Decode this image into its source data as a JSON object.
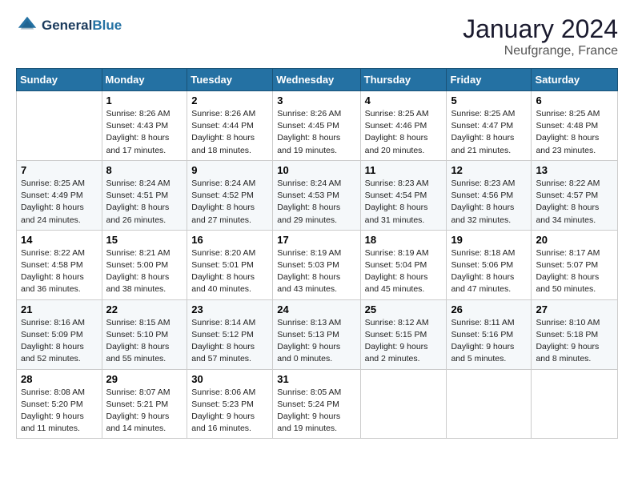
{
  "header": {
    "logo_line1": "General",
    "logo_line2": "Blue",
    "month": "January 2024",
    "location": "Neufgrange, France"
  },
  "weekdays": [
    "Sunday",
    "Monday",
    "Tuesday",
    "Wednesday",
    "Thursday",
    "Friday",
    "Saturday"
  ],
  "weeks": [
    [
      {
        "day": "",
        "info": ""
      },
      {
        "day": "1",
        "info": "Sunrise: 8:26 AM\nSunset: 4:43 PM\nDaylight: 8 hours\nand 17 minutes."
      },
      {
        "day": "2",
        "info": "Sunrise: 8:26 AM\nSunset: 4:44 PM\nDaylight: 8 hours\nand 18 minutes."
      },
      {
        "day": "3",
        "info": "Sunrise: 8:26 AM\nSunset: 4:45 PM\nDaylight: 8 hours\nand 19 minutes."
      },
      {
        "day": "4",
        "info": "Sunrise: 8:25 AM\nSunset: 4:46 PM\nDaylight: 8 hours\nand 20 minutes."
      },
      {
        "day": "5",
        "info": "Sunrise: 8:25 AM\nSunset: 4:47 PM\nDaylight: 8 hours\nand 21 minutes."
      },
      {
        "day": "6",
        "info": "Sunrise: 8:25 AM\nSunset: 4:48 PM\nDaylight: 8 hours\nand 23 minutes."
      }
    ],
    [
      {
        "day": "7",
        "info": "Sunrise: 8:25 AM\nSunset: 4:49 PM\nDaylight: 8 hours\nand 24 minutes."
      },
      {
        "day": "8",
        "info": "Sunrise: 8:24 AM\nSunset: 4:51 PM\nDaylight: 8 hours\nand 26 minutes."
      },
      {
        "day": "9",
        "info": "Sunrise: 8:24 AM\nSunset: 4:52 PM\nDaylight: 8 hours\nand 27 minutes."
      },
      {
        "day": "10",
        "info": "Sunrise: 8:24 AM\nSunset: 4:53 PM\nDaylight: 8 hours\nand 29 minutes."
      },
      {
        "day": "11",
        "info": "Sunrise: 8:23 AM\nSunset: 4:54 PM\nDaylight: 8 hours\nand 31 minutes."
      },
      {
        "day": "12",
        "info": "Sunrise: 8:23 AM\nSunset: 4:56 PM\nDaylight: 8 hours\nand 32 minutes."
      },
      {
        "day": "13",
        "info": "Sunrise: 8:22 AM\nSunset: 4:57 PM\nDaylight: 8 hours\nand 34 minutes."
      }
    ],
    [
      {
        "day": "14",
        "info": "Sunrise: 8:22 AM\nSunset: 4:58 PM\nDaylight: 8 hours\nand 36 minutes."
      },
      {
        "day": "15",
        "info": "Sunrise: 8:21 AM\nSunset: 5:00 PM\nDaylight: 8 hours\nand 38 minutes."
      },
      {
        "day": "16",
        "info": "Sunrise: 8:20 AM\nSunset: 5:01 PM\nDaylight: 8 hours\nand 40 minutes."
      },
      {
        "day": "17",
        "info": "Sunrise: 8:19 AM\nSunset: 5:03 PM\nDaylight: 8 hours\nand 43 minutes."
      },
      {
        "day": "18",
        "info": "Sunrise: 8:19 AM\nSunset: 5:04 PM\nDaylight: 8 hours\nand 45 minutes."
      },
      {
        "day": "19",
        "info": "Sunrise: 8:18 AM\nSunset: 5:06 PM\nDaylight: 8 hours\nand 47 minutes."
      },
      {
        "day": "20",
        "info": "Sunrise: 8:17 AM\nSunset: 5:07 PM\nDaylight: 8 hours\nand 50 minutes."
      }
    ],
    [
      {
        "day": "21",
        "info": "Sunrise: 8:16 AM\nSunset: 5:09 PM\nDaylight: 8 hours\nand 52 minutes."
      },
      {
        "day": "22",
        "info": "Sunrise: 8:15 AM\nSunset: 5:10 PM\nDaylight: 8 hours\nand 55 minutes."
      },
      {
        "day": "23",
        "info": "Sunrise: 8:14 AM\nSunset: 5:12 PM\nDaylight: 8 hours\nand 57 minutes."
      },
      {
        "day": "24",
        "info": "Sunrise: 8:13 AM\nSunset: 5:13 PM\nDaylight: 9 hours\nand 0 minutes."
      },
      {
        "day": "25",
        "info": "Sunrise: 8:12 AM\nSunset: 5:15 PM\nDaylight: 9 hours\nand 2 minutes."
      },
      {
        "day": "26",
        "info": "Sunrise: 8:11 AM\nSunset: 5:16 PM\nDaylight: 9 hours\nand 5 minutes."
      },
      {
        "day": "27",
        "info": "Sunrise: 8:10 AM\nSunset: 5:18 PM\nDaylight: 9 hours\nand 8 minutes."
      }
    ],
    [
      {
        "day": "28",
        "info": "Sunrise: 8:08 AM\nSunset: 5:20 PM\nDaylight: 9 hours\nand 11 minutes."
      },
      {
        "day": "29",
        "info": "Sunrise: 8:07 AM\nSunset: 5:21 PM\nDaylight: 9 hours\nand 14 minutes."
      },
      {
        "day": "30",
        "info": "Sunrise: 8:06 AM\nSunset: 5:23 PM\nDaylight: 9 hours\nand 16 minutes."
      },
      {
        "day": "31",
        "info": "Sunrise: 8:05 AM\nSunset: 5:24 PM\nDaylight: 9 hours\nand 19 minutes."
      },
      {
        "day": "",
        "info": ""
      },
      {
        "day": "",
        "info": ""
      },
      {
        "day": "",
        "info": ""
      }
    ]
  ]
}
